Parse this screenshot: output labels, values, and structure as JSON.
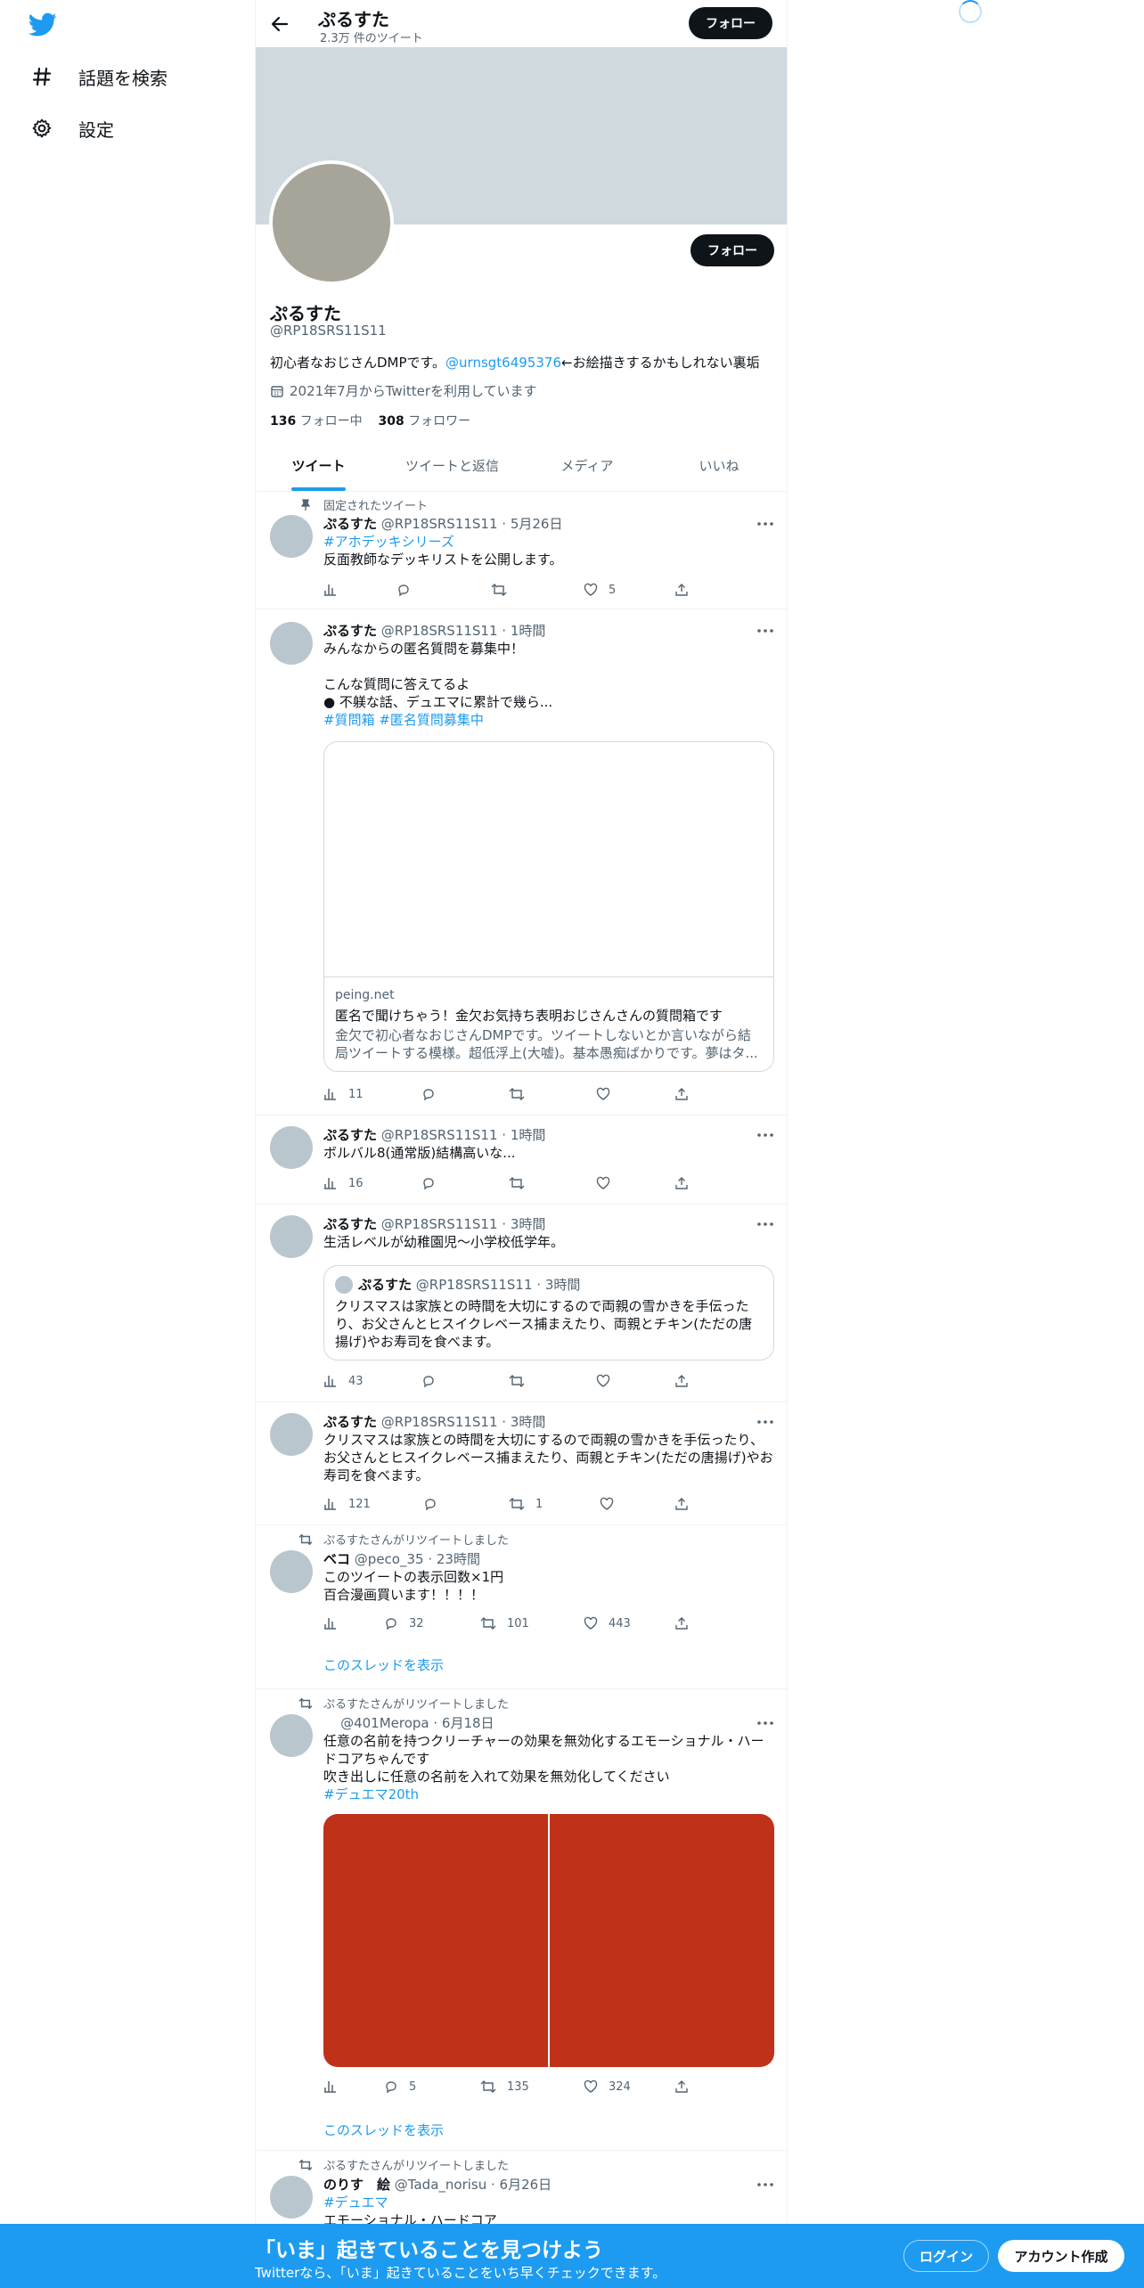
{
  "nav": {
    "items": [
      {
        "label": "話題を検索",
        "icon": "hashtag-icon"
      },
      {
        "label": "設定",
        "icon": "gear-icon"
      }
    ]
  },
  "header": {
    "name": "ぷるすた",
    "tweet_count": "2.3万 件のツイート",
    "follow_label": "フォロー"
  },
  "profile": {
    "name": "ぷるすた",
    "handle": "@RP18SRS11S11",
    "bio_prefix": "初心者なおじさんDMPです。",
    "bio_mention": "@urnsgt6495376",
    "bio_suffix": "←お絵描きするかもしれない裏垢",
    "joined": "2021年7月からTwitterを利用しています",
    "following_count": "136",
    "following_label": "フォロー中",
    "followers_count": "308",
    "followers_label": "フォロワー",
    "follow_label": "フォロー"
  },
  "tabs": [
    "ツイート",
    "ツイートと返信",
    "メディア",
    "いいね"
  ],
  "tweets": [
    {
      "context": "固定されたツイート",
      "name": "ぷるすた",
      "meta": "@RP18SRS11S11 · 5月26日",
      "hashtags": "#アホデッキシリーズ",
      "text": "反面教師なデッキリストを公開します。",
      "views": "",
      "replies": "",
      "retweets": "",
      "likes": "5"
    },
    {
      "name": "ぷるすた",
      "meta": "@RP18SRS11S11 · 1時間",
      "text": "みんなからの匿名質問を募集中！\n\nこんな質問に答えてるよ\n● 不躾な話、デュエマに累計で幾ら...",
      "hashtags": "#質問箱 #匿名質問募集中",
      "card": {
        "domain": "peing.net",
        "title": "匿名で聞けちゃう！金欠お気持ち表明おじさんさんの質問箱です",
        "desc": "金欠で初心者なおじさんDMPです。ツイートしないとか言いながら結局ツイートする模様。超低浮上(大嘘)。基本愚痴ばかりです。夢はタ..."
      },
      "views": "11",
      "replies": "",
      "retweets": "",
      "likes": ""
    },
    {
      "name": "ぷるすた",
      "meta": "@RP18SRS11S11 · 1時間",
      "text": "ボルバル8(通常版)結構高いな...",
      "views": "16",
      "replies": "",
      "retweets": "",
      "likes": ""
    },
    {
      "name": "ぷるすた",
      "meta": "@RP18SRS11S11 · 3時間",
      "text": "生活レベルが幼稚園児〜小学校低学年。",
      "quote": {
        "name": "ぷるすた",
        "meta": "@RP18SRS11S11 · 3時間",
        "text": "クリスマスは家族との時間を大切にするので両親の雪かきを手伝ったり、お父さんとヒスイクレベース捕まえたり、両親とチキン(ただの唐揚げ)やお寿司を食べます。"
      },
      "views": "43",
      "replies": "",
      "retweets": "",
      "likes": ""
    },
    {
      "name": "ぷるすた",
      "meta": "@RP18SRS11S11 · 3時間",
      "text": "クリスマスは家族との時間を大切にするので両親の雪かきを手伝ったり、お父さんとヒスイクレベース捕まえたり、両親とチキン(ただの唐揚げ)やお寿司を食べます。",
      "views": "121",
      "replies": "",
      "retweets": "1",
      "likes": ""
    },
    {
      "context": "ぷるすたさんがリツイートしました",
      "name": "ベコ",
      "meta": "@peco_35 · 23時間",
      "text": "このツイートの表示回数×1円\n百合漫画買います！！！！",
      "views": "",
      "replies": "32",
      "retweets": "101",
      "likes": "443",
      "show_thread": "このスレッドを表示"
    },
    {
      "context": "ぷるすたさんがリツイートしました",
      "name": "",
      "meta": "@401Meropa · 6月18日",
      "text": "任意の名前を持つクリーチャーの効果を無効化するエモーショナル・ハードコアちゃんです\n吹き出しに任意の名前を入れて効果を無効化してください",
      "hashtags": "#デュエマ20th",
      "views": "",
      "replies": "5",
      "retweets": "135",
      "likes": "324",
      "show_thread": "このスレッドを表示"
    },
    {
      "context": "ぷるすたさんがリツイートしました",
      "name": "のりす　絵",
      "meta": "@Tada_norisu · 6月26日",
      "hashtags": "#デュエマ",
      "text": "エモーショナル・ハードコア"
    }
  ],
  "bottombar": {
    "title": "「いま」起きていることを見つけよう",
    "subtitle": "Twitterなら、「いま」起きていることをいち早くチェックできます。",
    "login": "ログイン",
    "signup": "アカウント作成"
  },
  "colors": {
    "accent": "#1d9bf0",
    "banner": "#cfd9de",
    "media": "#bf3118"
  }
}
